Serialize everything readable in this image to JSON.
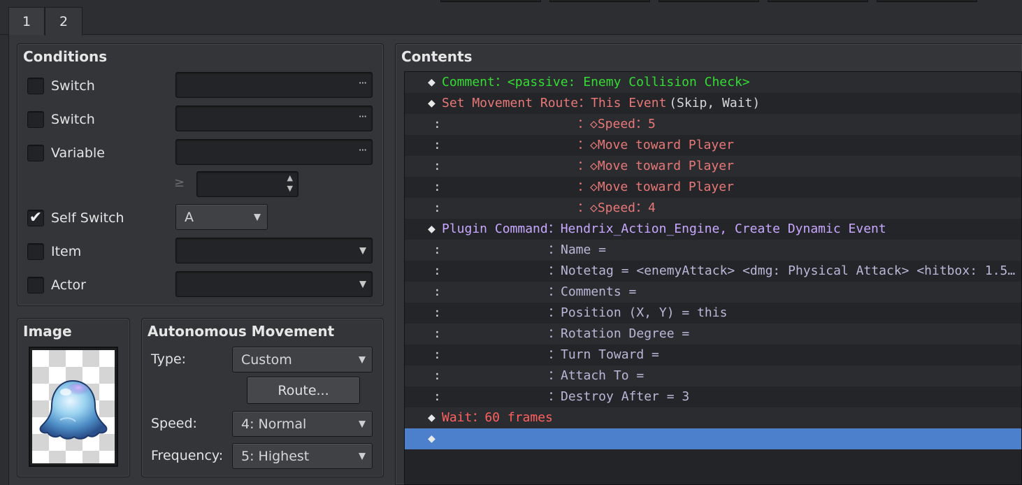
{
  "tabs": [
    {
      "label": "1",
      "active": false
    },
    {
      "label": "2",
      "active": true
    }
  ],
  "conditions": {
    "title": "Conditions",
    "rows": [
      {
        "label": "Switch",
        "checked": false,
        "value": "",
        "control": "dots"
      },
      {
        "label": "Switch",
        "checked": false,
        "value": "",
        "control": "dots"
      },
      {
        "label": "Variable",
        "checked": false,
        "value": "",
        "control": "dots"
      },
      {
        "label": "Self Switch",
        "checked": true,
        "value": "A",
        "control": "combo"
      },
      {
        "label": "Item",
        "checked": false,
        "value": "",
        "control": "select"
      },
      {
        "label": "Actor",
        "checked": false,
        "value": "",
        "control": "select"
      }
    ],
    "variable_operator": "≥",
    "variable_value": ""
  },
  "image": {
    "title": "Image",
    "sprite": "blue-slime-sprite"
  },
  "autonomous": {
    "title": "Autonomous Movement",
    "type_label": "Type:",
    "type_value": "Custom",
    "route_button": "Route...",
    "speed_label": "Speed:",
    "speed_value": "4: Normal",
    "frequency_label": "Frequency:",
    "frequency_value": "5: Highest"
  },
  "contents": {
    "title": "Contents",
    "rows": [
      {
        "indent": "",
        "parts": [
          {
            "t": "◆",
            "c": "diamond"
          },
          {
            "t": "Comment：<passive: Enemy Collision Check>",
            "c": "c-comment"
          }
        ]
      },
      {
        "indent": "",
        "parts": [
          {
            "t": "◆",
            "c": "diamond"
          },
          {
            "t": "Set Movement Route：This Event ",
            "c": "c-move"
          },
          {
            "t": "(Skip, Wait)",
            "c": "c-white"
          }
        ]
      },
      {
        "indent": "：",
        "pad": "c-move",
        "parts": [
          {
            "t": "：◇Speed：5",
            "c": "c-move"
          }
        ]
      },
      {
        "indent": "：",
        "pad": "c-move",
        "parts": [
          {
            "t": "：◇Move toward Player",
            "c": "c-move"
          }
        ]
      },
      {
        "indent": "：",
        "pad": "c-move",
        "parts": [
          {
            "t": "：◇Move toward Player",
            "c": "c-move"
          }
        ]
      },
      {
        "indent": "：",
        "pad": "c-move",
        "parts": [
          {
            "t": "：◇Move toward Player",
            "c": "c-move"
          }
        ]
      },
      {
        "indent": "：",
        "pad": "c-move",
        "parts": [
          {
            "t": "：◇Speed：4",
            "c": "c-move"
          }
        ]
      },
      {
        "indent": "",
        "parts": [
          {
            "t": "◆",
            "c": "diamond"
          },
          {
            "t": "Plugin Command：Hendrix_Action_Engine, Create Dynamic Event",
            "c": "c-plugin"
          }
        ]
      },
      {
        "indent": "：",
        "pad": "plugin",
        "parts": [
          {
            "t": "：Name =",
            "c": "c-pluginarg"
          }
        ]
      },
      {
        "indent": "：",
        "pad": "plugin",
        "parts": [
          {
            "t": "：Notetag = <enemyAttack> <dmg: Physical Attack> <hitbox: 1.5…",
            "c": "c-pluginarg"
          }
        ]
      },
      {
        "indent": "：",
        "pad": "plugin",
        "parts": [
          {
            "t": "：Comments =",
            "c": "c-pluginarg"
          }
        ]
      },
      {
        "indent": "：",
        "pad": "plugin",
        "parts": [
          {
            "t": "：Position (X, Y) = this",
            "c": "c-pluginarg"
          }
        ]
      },
      {
        "indent": "：",
        "pad": "plugin",
        "parts": [
          {
            "t": "：Rotation Degree =",
            "c": "c-pluginarg"
          }
        ]
      },
      {
        "indent": "：",
        "pad": "plugin",
        "parts": [
          {
            "t": "：Turn Toward =",
            "c": "c-pluginarg"
          }
        ]
      },
      {
        "indent": "：",
        "pad": "plugin",
        "parts": [
          {
            "t": "：Attach To =",
            "c": "c-pluginarg"
          }
        ]
      },
      {
        "indent": "：",
        "pad": "plugin",
        "parts": [
          {
            "t": "：Destroy After = 3",
            "c": "c-pluginarg"
          }
        ]
      },
      {
        "indent": "",
        "parts": [
          {
            "t": "◆",
            "c": "diamond"
          },
          {
            "t": "Wait：60 frames",
            "c": "c-wait"
          }
        ]
      },
      {
        "indent": "",
        "selected": true,
        "parts": [
          {
            "t": "◆",
            "c": "diamond"
          }
        ]
      }
    ]
  }
}
